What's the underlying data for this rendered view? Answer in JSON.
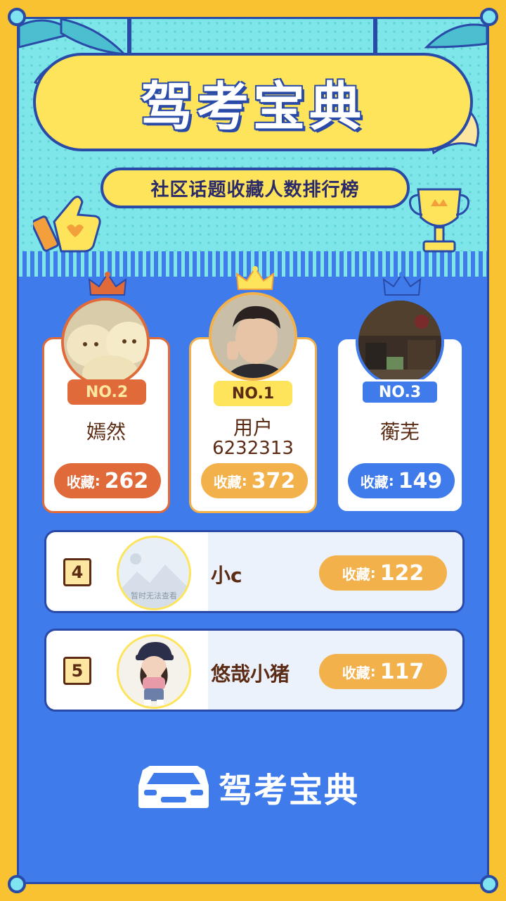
{
  "header": {
    "title": "驾考宝典",
    "subtitle": "社区话题收藏人数排行榜"
  },
  "colors": {
    "frame": "#f8c230",
    "background": "#3f7bea",
    "rank1": "#f3b14c",
    "rank2": "#e06a3a",
    "rank3": "#3f7bea",
    "name_text": "#5b2b14"
  },
  "podium": [
    {
      "badge": "NO.2",
      "name": "嫣然",
      "label": "收藏",
      "colon": ":",
      "count": "262",
      "crown_icon": "crown-orange-icon"
    },
    {
      "badge": "NO.1",
      "name": "用户",
      "name_line2": "6232313",
      "label": "收藏",
      "colon": ":",
      "count": "372",
      "crown_icon": "crown-gold-icon"
    },
    {
      "badge": "NO.3",
      "name": "蘅芜",
      "label": "收藏",
      "colon": ":",
      "count": "149",
      "crown_icon": "crown-blue-icon"
    }
  ],
  "list": [
    {
      "rank": "4",
      "name": "小c",
      "label": "收藏",
      "colon": ":",
      "count": "122",
      "avatar_caption": "暂时无法查看"
    },
    {
      "rank": "5",
      "name": "悠哉小猪",
      "label": "收藏",
      "colon": ":",
      "count": "117"
    }
  ],
  "footer": {
    "brand": "驾考宝典",
    "logo_icon": "car-icon"
  }
}
